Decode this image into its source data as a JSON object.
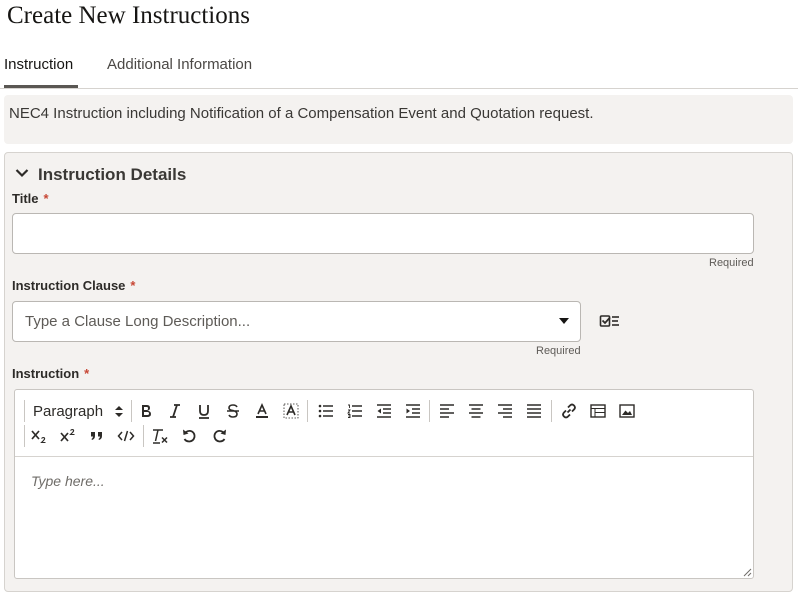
{
  "page": {
    "title": "Create New Instructions"
  },
  "tabs": [
    {
      "label": "Instruction",
      "active": true
    },
    {
      "label": "Additional Information",
      "active": false
    }
  ],
  "banner": {
    "text": "NEC4 Instruction including Notification of a Compensation Event and Quotation request."
  },
  "section": {
    "title": "Instruction Details",
    "expanded": true
  },
  "fields": {
    "title": {
      "label": "Title",
      "required_mark": "*",
      "value": "",
      "helper": "Required"
    },
    "clause": {
      "label": "Instruction Clause",
      "required_mark": "*",
      "placeholder": "Type a Clause Long Description...",
      "helper": "Required"
    },
    "instruction": {
      "label": "Instruction",
      "required_mark": "*",
      "placeholder": "Type here..."
    }
  },
  "editor": {
    "format_select": "Paragraph",
    "toolbar_row1": [
      "bold-icon",
      "italic-icon",
      "underline-icon",
      "strikethrough-icon",
      "font-color-icon",
      "highlight-icon",
      "bulleted-list-icon",
      "numbered-list-icon",
      "outdent-icon",
      "indent-icon",
      "align-left-icon",
      "align-center-icon",
      "align-right-icon",
      "justify-icon",
      "link-icon",
      "table-icon",
      "image-icon"
    ],
    "toolbar_row2": [
      "subscript-icon",
      "superscript-icon",
      "blockquote-icon",
      "code-icon",
      "clear-format-icon",
      "undo-icon",
      "redo-icon"
    ]
  },
  "colors": {
    "required_star": "#c74634",
    "panel_bg": "#f4f2f0",
    "tab_underline": "#5a5753"
  }
}
